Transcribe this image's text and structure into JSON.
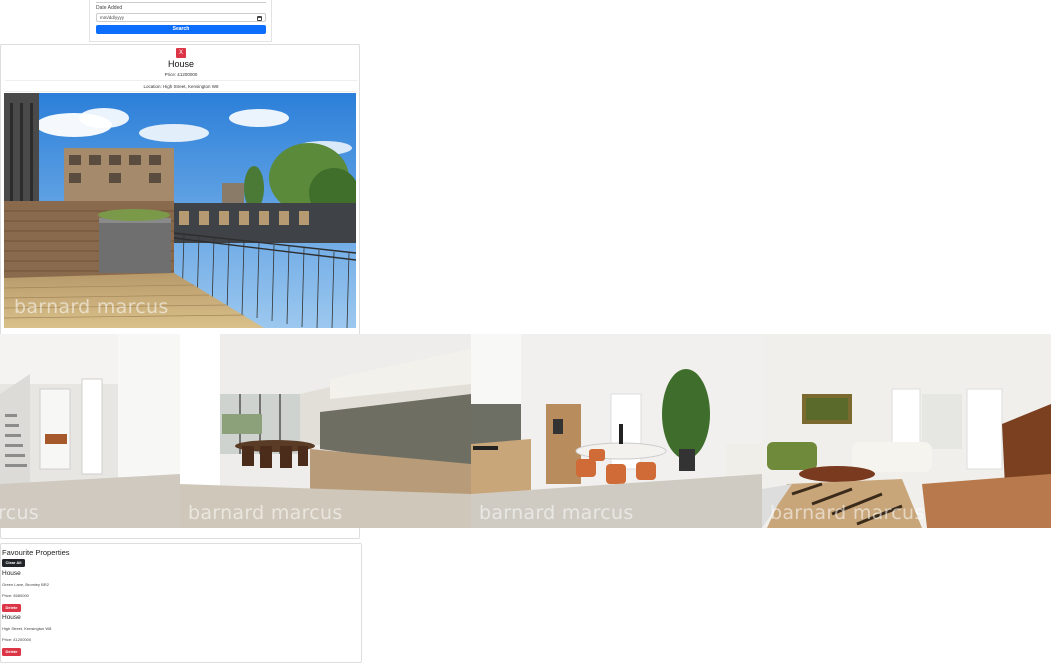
{
  "search_form": {
    "date_label": "Date Added",
    "date_placeholder": "mm/dd/yyyy",
    "search_button": "Search"
  },
  "detail": {
    "close_label": "X",
    "title": "House",
    "price": "Price: £1200000",
    "location": "Location: High Street, Kensington W8",
    "watermark": "barnard marcus"
  },
  "gallery": {
    "watermarks": [
      "rcus",
      "barnard marcus",
      "barnard marcus",
      "barnard marcus"
    ]
  },
  "favourites": {
    "heading": "Favourite Properties",
    "clear_button": "Clear All",
    "items": [
      {
        "title": "House",
        "location": "Green Lane, Bromley BR2",
        "price": "Price: £680000",
        "delete_label": "Delete"
      },
      {
        "title": "House",
        "location": "High Street, Kensington W8",
        "price": "Price: £1200000",
        "delete_label": "Delete"
      }
    ]
  },
  "colors": {
    "primary": "#0d6efd",
    "danger": "#dc3545",
    "dark": "#212529"
  }
}
